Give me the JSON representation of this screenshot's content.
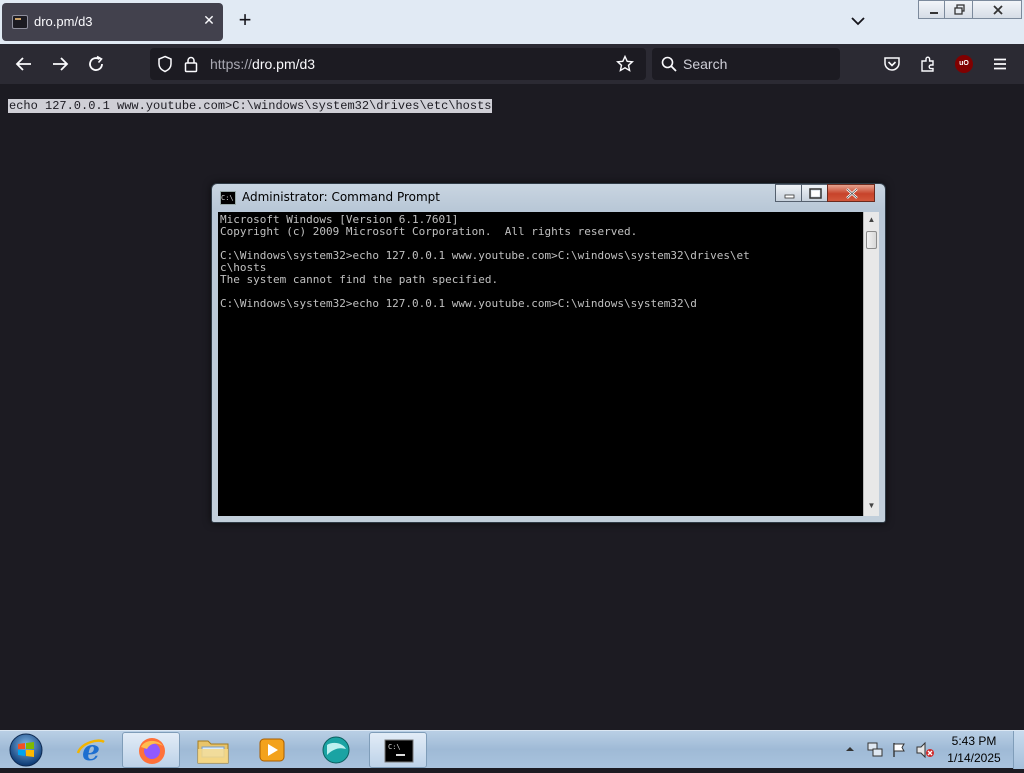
{
  "browser": {
    "tab": {
      "title": "dro.pm/d3"
    },
    "url": {
      "scheme": "https://",
      "rest": "dro.pm/d3"
    },
    "search": {
      "placeholder": "Search"
    },
    "ublock_badge": "uO"
  },
  "page": {
    "selected_text": "echo 127.0.0.1 www.youtube.com>C:\\windows\\system32\\drives\\etc\\hosts"
  },
  "cmd": {
    "title": "Administrator: Command Prompt",
    "lines": [
      "Microsoft Windows [Version 6.1.7601]",
      "Copyright (c) 2009 Microsoft Corporation.  All rights reserved.",
      "",
      "C:\\Windows\\system32>echo 127.0.0.1 www.youtube.com>C:\\windows\\system32\\drives\\et",
      "c\\hosts",
      "The system cannot find the path specified.",
      "",
      "C:\\Windows\\system32>echo 127.0.0.1 www.youtube.com>C:\\windows\\system32\\d"
    ]
  },
  "taskbar": {
    "clock_time": "5:43 PM",
    "clock_date": "1/14/2025",
    "items": [
      "internet-explorer",
      "firefox",
      "windows-explorer",
      "media-player",
      "app",
      "command-prompt"
    ]
  }
}
